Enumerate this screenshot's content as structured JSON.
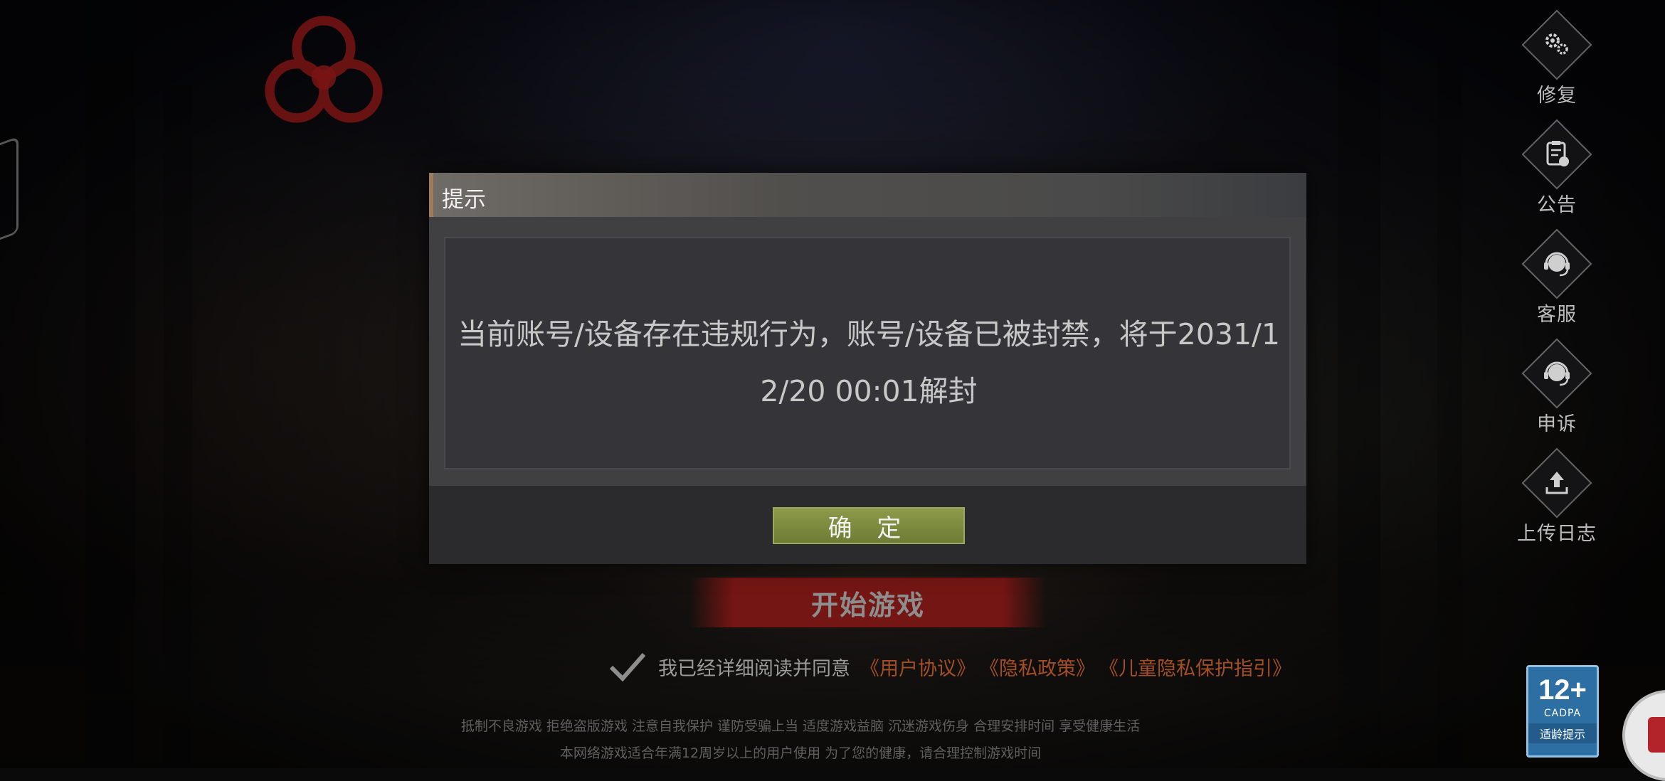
{
  "dialog": {
    "title": "提示",
    "message": "当前账号/设备存在违规行为，账号/设备已被封禁，将于2031/12/20 00:01解封",
    "confirm_label": "确 定"
  },
  "side_menu": [
    {
      "name": "repair",
      "icon": "gear-icon",
      "label": "修复"
    },
    {
      "name": "notice",
      "icon": "clipboard-icon",
      "label": "公告"
    },
    {
      "name": "support",
      "icon": "headset-icon",
      "label": "客服"
    },
    {
      "name": "appeal",
      "icon": "headset-icon",
      "label": "申诉"
    },
    {
      "name": "upload-log",
      "icon": "upload-icon",
      "label": "上传日志"
    }
  ],
  "start_button": {
    "label": "开始游戏"
  },
  "agreement": {
    "text": "我已经详细阅读并同意",
    "links": [
      "《用户协议》",
      "《隐私政策》",
      "《儿童隐私保护指引》"
    ]
  },
  "footer": {
    "line1": "抵制不良游戏 拒绝盗版游戏 注意自我保护 谨防受骗上当 适度游戏益脑 沉迷游戏伤身 合理安排时间 享受健康生活",
    "line2": "本网络游戏适合年满12周岁以上的用户使用   为了您的健康，请合理控制游戏时间"
  },
  "age_badge": {
    "age": "12+",
    "org": "CADPA",
    "tip": "适龄提示"
  },
  "colors": {
    "confirm_button": "#7a8a3e",
    "start_button": "#7a1a18",
    "link": "#a24e26",
    "age_badge": "#2d6ea3"
  }
}
